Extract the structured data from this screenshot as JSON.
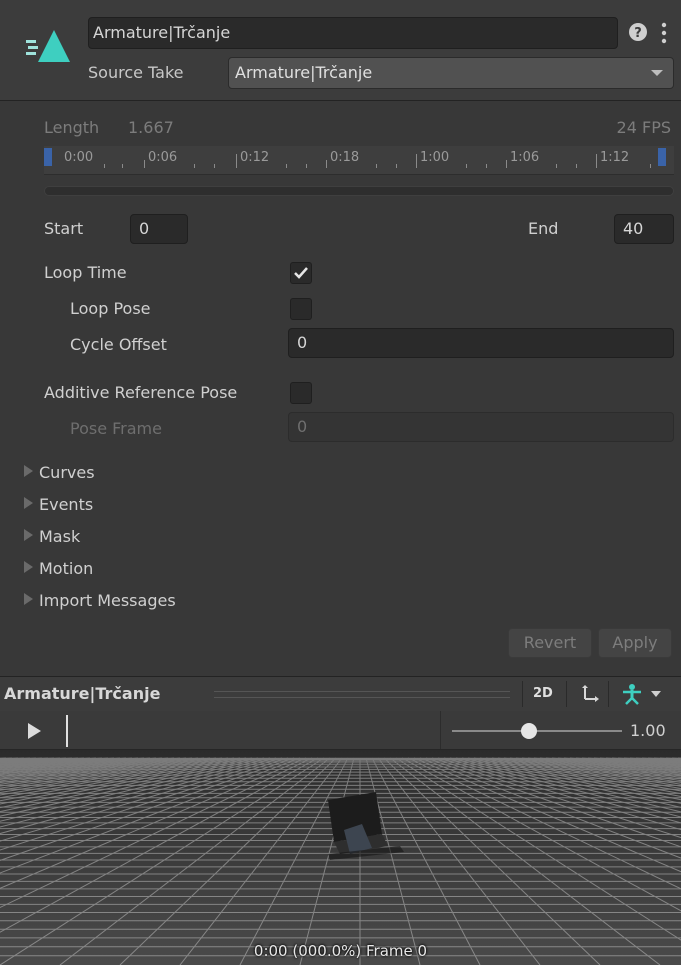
{
  "header": {
    "clip_name": "Armature|Trčanje",
    "source_take_label": "Source Take",
    "source_take_value": "Armature|Trčanje"
  },
  "timing": {
    "length_label": "Length",
    "length_value": "1.667",
    "fps": "24 FPS",
    "ruler_labels": [
      "0:00",
      "0:06",
      "0:12",
      "0:18",
      "1:00",
      "1:06",
      "1:12"
    ],
    "start_label": "Start",
    "start_value": "0",
    "end_label": "End",
    "end_value": "40"
  },
  "settings": {
    "loop_time_label": "Loop Time",
    "loop_time_checked": true,
    "loop_pose_label": "Loop Pose",
    "loop_pose_checked": false,
    "cycle_offset_label": "Cycle Offset",
    "cycle_offset_value": "0",
    "additive_ref_label": "Additive Reference Pose",
    "additive_ref_checked": false,
    "pose_frame_label": "Pose Frame",
    "pose_frame_value": "0"
  },
  "foldouts": [
    "Curves",
    "Events",
    "Mask",
    "Motion",
    "Import Messages"
  ],
  "buttons": {
    "revert": "Revert",
    "apply": "Apply"
  },
  "preview": {
    "title": "Armature|Trčanje",
    "mode_2d": "2D",
    "speed": "1.00",
    "speed_fraction": 0.45,
    "frame_info": "0:00 (000.0%) Frame 0"
  },
  "colors": {
    "accent": "#3ecfc0",
    "background": "#383838"
  }
}
